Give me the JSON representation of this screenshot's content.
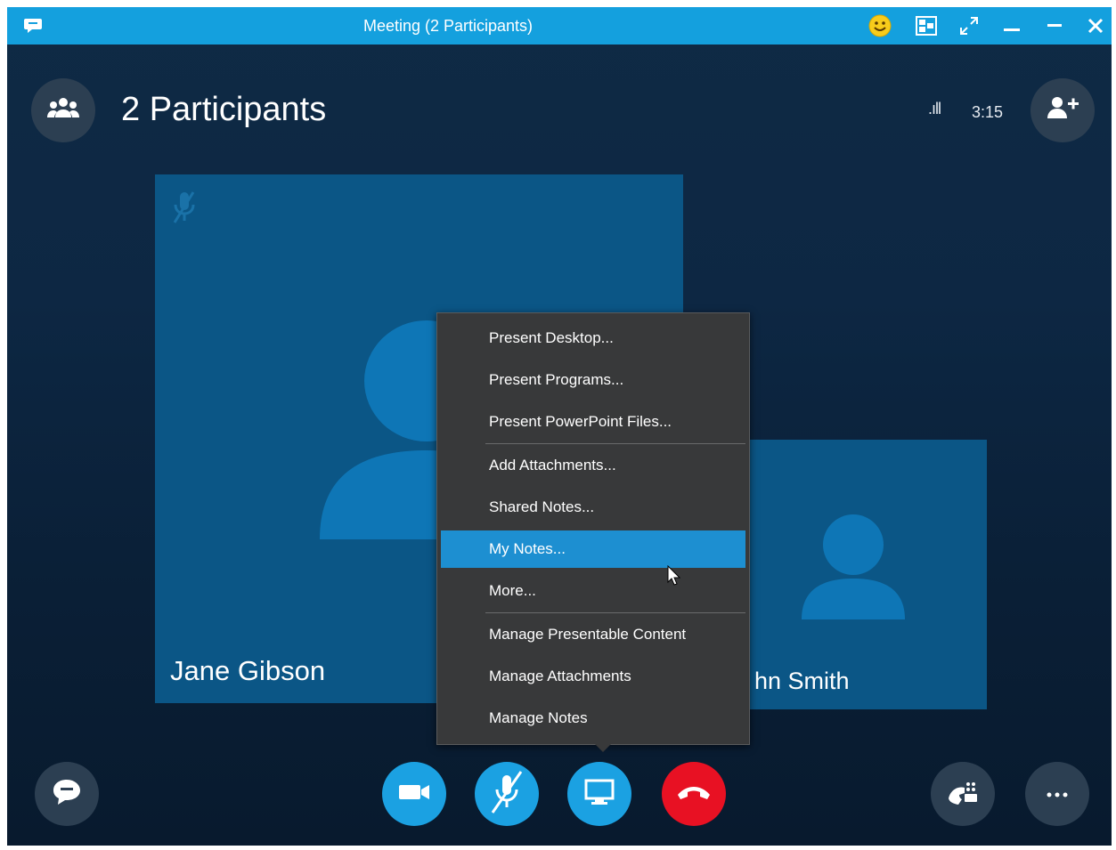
{
  "window": {
    "title": "Meeting (2 Participants)"
  },
  "header": {
    "participants_label": "2 Participants",
    "signal": ".ıll",
    "timer": "3:15"
  },
  "participants": [
    {
      "name": "Jane Gibson",
      "muted": true
    },
    {
      "name": "hn Smith"
    }
  ],
  "share_menu": {
    "items": [
      {
        "label": "Present Desktop..."
      },
      {
        "label": "Present Programs..."
      },
      {
        "label": "Present PowerPoint Files..."
      },
      {
        "label": "Add Attachments..."
      },
      {
        "label": "Shared Notes..."
      },
      {
        "label": "My Notes...",
        "highlighted": true
      },
      {
        "label": "More..."
      },
      {
        "label": "Manage Presentable Content"
      },
      {
        "label": "Manage Attachments"
      },
      {
        "label": "Manage Notes"
      }
    ]
  },
  "icons": {
    "app": "chat-bubble-icon",
    "emoticon": "smiley-icon",
    "compact": "compact-view-icon",
    "fullscreen": "expand-icon",
    "participants": "people-icon",
    "add_person": "add-person-icon",
    "im": "chat-icon",
    "video": "video-camera-icon",
    "mic": "microphone-muted-icon",
    "present": "monitor-icon",
    "hangup": "hang-up-icon",
    "call_controls": "dial-pad-icon",
    "more": "ellipsis-icon"
  },
  "colors": {
    "titlebar": "#14a0de",
    "accent": "#1ba1e2",
    "hangup": "#e81123",
    "menu_bg": "#38393a",
    "menu_highlight": "#1d8fd1",
    "tile": "#0b5686"
  }
}
